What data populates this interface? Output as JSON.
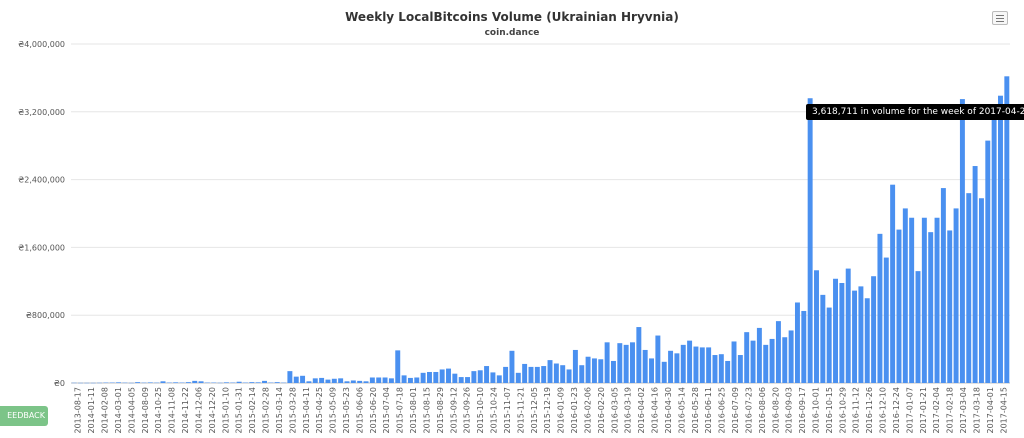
{
  "chart_data": {
    "type": "bar",
    "title": "Weekly LocalBitcoins Volume (Ukrainian Hryvnia)",
    "subtitle": "coin.dance",
    "ylim": [
      0,
      4000000
    ],
    "y_ticks": [
      "₴0",
      "₴800,000",
      "₴1,600,000",
      "₴2,400,000",
      "₴3,200,000",
      "₴4,000,000"
    ],
    "y_tick_values": [
      0,
      800000,
      1600000,
      2400000,
      3200000,
      4000000
    ],
    "x_tick_labels": [
      "2013-08-17",
      "2014-01-11",
      "2014-02-08",
      "2014-03-01",
      "2014-04-05",
      "2014-08-09",
      "2014-10-25",
      "2014-11-08",
      "2014-11-22",
      "2014-12-06",
      "2014-12-20",
      "2015-01-10",
      "2015-01-31",
      "2015-02-14",
      "2015-02-28",
      "2015-03-14",
      "2015-03-28",
      "2015-04-11",
      "2015-04-25",
      "2015-05-09",
      "2015-05-23",
      "2015-06-06",
      "2015-06-20",
      "2015-07-04",
      "2015-07-18",
      "2015-08-01",
      "2015-08-15",
      "2015-08-29",
      "2015-09-12",
      "2015-09-26",
      "2015-10-10",
      "2015-10-24",
      "2015-11-07",
      "2015-11-21",
      "2015-12-05",
      "2015-12-19",
      "2016-01-09",
      "2016-01-23",
      "2016-02-06",
      "2016-02-20",
      "2016-03-05",
      "2016-03-19",
      "2016-04-02",
      "2016-04-16",
      "2016-04-30",
      "2016-05-14",
      "2016-05-28",
      "2016-06-11",
      "2016-06-25",
      "2016-07-09",
      "2016-07-23",
      "2016-08-06",
      "2016-08-20",
      "2016-09-03",
      "2016-09-17",
      "2016-10-01",
      "2016-10-15",
      "2016-10-29",
      "2016-11-12",
      "2016-11-26",
      "2016-12-10",
      "2016-12-24",
      "2017-01-07",
      "2017-01-21",
      "2017-02-04",
      "2017-02-18",
      "2017-03-04",
      "2017-03-18",
      "2017-04-01",
      "2017-04-15"
    ],
    "values": [
      3000,
      2000,
      2000,
      2000,
      3000,
      5000,
      5000,
      8000,
      4000,
      2000,
      10000,
      4000,
      7000,
      4000,
      20000,
      5000,
      8000,
      5000,
      10000,
      25000,
      20000,
      5000,
      5000,
      3000,
      8000,
      5000,
      15000,
      5000,
      10000,
      8000,
      25000,
      5000,
      10000,
      4000,
      140000,
      75000,
      85000,
      20000,
      55000,
      60000,
      40000,
      50000,
      55000,
      20000,
      30000,
      25000,
      20000,
      65000,
      65000,
      65000,
      55000,
      385000,
      90000,
      60000,
      65000,
      120000,
      130000,
      130000,
      160000,
      170000,
      110000,
      70000,
      70000,
      140000,
      150000,
      200000,
      125000,
      90000,
      190000,
      380000,
      120000,
      225000,
      190000,
      190000,
      200000,
      270000,
      230000,
      210000,
      160000,
      390000,
      210000,
      310000,
      290000,
      280000,
      480000,
      260000,
      470000,
      450000,
      480000,
      660000,
      390000,
      290000,
      560000,
      250000,
      380000,
      350000,
      450000,
      500000,
      430000,
      420000,
      420000,
      330000,
      340000,
      260000,
      490000,
      330000,
      600000,
      500000,
      650000,
      450000,
      520000,
      730000,
      540000,
      620000,
      950000,
      850000,
      3360000,
      1330000,
      1040000,
      890000,
      1230000,
      1180000,
      1350000,
      1090000,
      1140000,
      1000000,
      1260000,
      1760000,
      1480000,
      2340000,
      1810000,
      2060000,
      1950000,
      1320000,
      1950000,
      1780000,
      1950000,
      2300000,
      1800000,
      2060000,
      3350000,
      2240000,
      2560000,
      2180000,
      2860000,
      3220000,
      3390000,
      3618711
    ],
    "bar_color": "#4a90f0",
    "grid": true,
    "legend": "none"
  },
  "tooltip": {
    "text": "3,618,711 in volume for the week of 2017-04-22"
  },
  "ui": {
    "menu_icon": "hamburger-menu-icon",
    "feedback_label": "EEDBACK",
    "feedback_color": "#7cc488"
  }
}
